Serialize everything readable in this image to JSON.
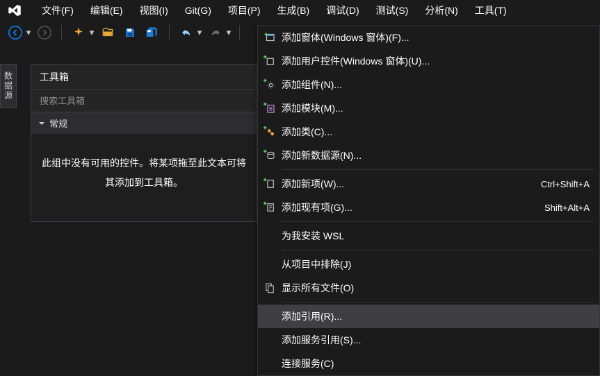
{
  "menubar": {
    "file": "文件(F)",
    "edit": "编辑(E)",
    "view": "视图(I)",
    "git": "Git(G)",
    "project": "项目(P)",
    "build": "生成(B)",
    "debug": "调试(D)",
    "test": "测试(S)",
    "analyze": "分析(N)",
    "tools": "工具(T)"
  },
  "side_tab": "数据源",
  "toolbox": {
    "title": "工具箱",
    "search_placeholder": "搜索工具箱",
    "category": "常规",
    "empty": "此组中没有可用的控件。将某项拖至此文本可将其添加到工具箱。"
  },
  "menu_items": [
    {
      "label": "添加窗体(Windows 窗体)(F)...",
      "icon": "form-add"
    },
    {
      "label": "添加用户控件(Windows 窗体)(U)...",
      "icon": "usercontrol-add"
    },
    {
      "label": "添加组件(N)...",
      "icon": "component-add"
    },
    {
      "label": "添加模块(M)...",
      "icon": "module-add"
    },
    {
      "label": "添加类(C)...",
      "icon": "class-add"
    },
    {
      "label": "添加新数据源(N)...",
      "icon": "datasource-add"
    },
    {
      "divider": true
    },
    {
      "label": "添加新项(W)...",
      "icon": "newitem-add",
      "shortcut": "Ctrl+Shift+A"
    },
    {
      "label": "添加现有项(G)...",
      "icon": "existingitem-add",
      "shortcut": "Shift+Alt+A"
    },
    {
      "divider": true
    },
    {
      "label": "为我安装 WSL",
      "icon": null
    },
    {
      "divider": true
    },
    {
      "label": "从项目中排除(J)",
      "icon": null
    },
    {
      "label": "显示所有文件(O)",
      "icon": "show-all-files"
    },
    {
      "divider": true
    },
    {
      "label": "添加引用(R)...",
      "icon": null,
      "hovered": true
    },
    {
      "label": "添加服务引用(S)...",
      "icon": null
    },
    {
      "label": "连接服务(C)",
      "icon": null
    }
  ]
}
